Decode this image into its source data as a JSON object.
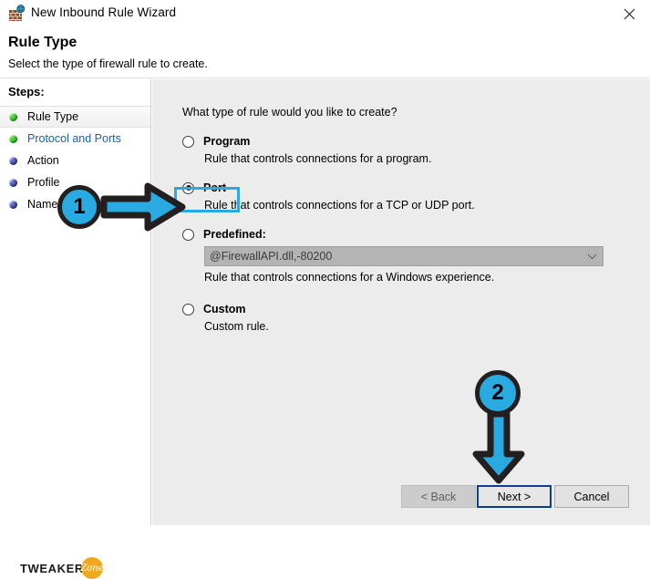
{
  "window": {
    "title": "New Inbound Rule Wizard",
    "icon": "firewall-globe-icon",
    "close_label": "✕"
  },
  "header": {
    "title": "Rule Type",
    "subtitle": "Select the type of firewall rule to create."
  },
  "sidebar": {
    "steps_label": "Steps:",
    "items": [
      {
        "label": "Rule Type",
        "bullet": "green",
        "active": true,
        "link": false
      },
      {
        "label": "Protocol and Ports",
        "bullet": "green",
        "active": false,
        "link": true
      },
      {
        "label": "Action",
        "bullet": "blue",
        "active": false,
        "link": false
      },
      {
        "label": "Profile",
        "bullet": "blue",
        "active": false,
        "link": false
      },
      {
        "label": "Name",
        "bullet": "blue",
        "active": false,
        "link": false
      }
    ],
    "logo": {
      "word": "TWEAKER",
      "badge": "Zone"
    }
  },
  "main": {
    "question": "What type of rule would you like to create?",
    "options": [
      {
        "id": "program",
        "label": "Program",
        "description": "Rule that controls connections for a program.",
        "selected": false
      },
      {
        "id": "port",
        "label": "Port",
        "description": "Rule that controls connections for a TCP or UDP port.",
        "selected": true
      },
      {
        "id": "predefined",
        "label": "Predefined:",
        "description": "Rule that controls connections for a Windows experience.",
        "selected": false,
        "combo_value": "@FirewallAPI.dll,-80200",
        "combo_disabled": true
      },
      {
        "id": "custom",
        "label": "Custom",
        "description": "Custom rule.",
        "selected": false
      }
    ]
  },
  "footer": {
    "back_label": "< Back",
    "next_label": "Next >",
    "cancel_label": "Cancel"
  },
  "annotations": {
    "step_one": "1",
    "step_two": "2",
    "accent_color": "#29abe2",
    "outline_color": "#231f20"
  }
}
